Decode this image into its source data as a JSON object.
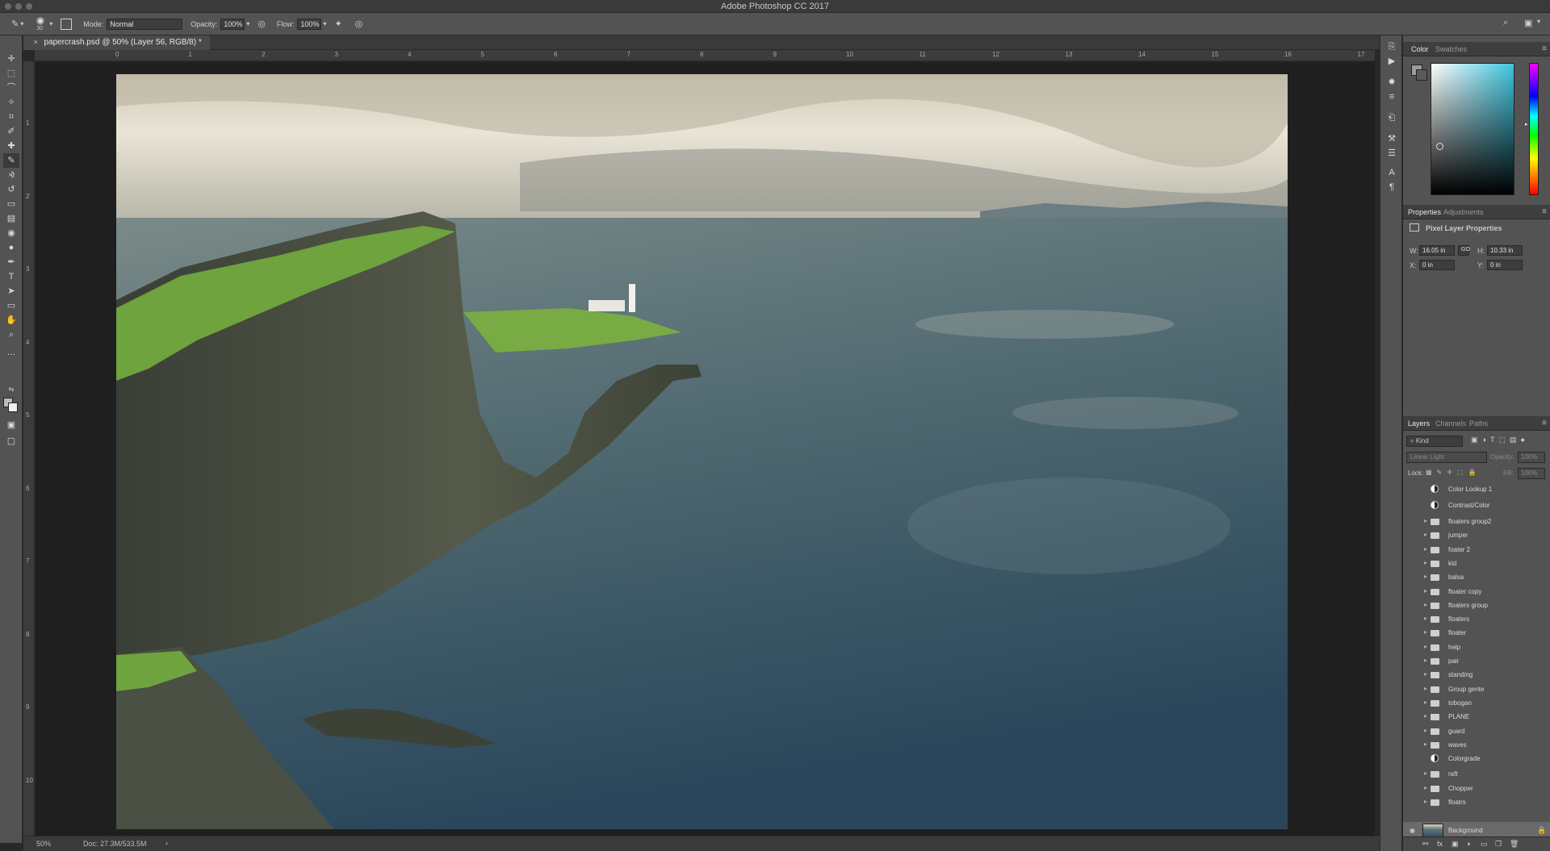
{
  "window": {
    "title": "Adobe Photoshop CC 2017"
  },
  "options": {
    "brush_size": "30",
    "mode_label": "Mode:",
    "mode_value": "Normal",
    "opacity_label": "Opacity:",
    "opacity_value": "100%",
    "flow_label": "Flow:",
    "flow_value": "100%"
  },
  "document": {
    "tab_title": "papercrash.psd @ 50% (Layer 56, RGB/8) *"
  },
  "rulers": {
    "top": [
      "0",
      "1",
      "2",
      "3",
      "4",
      "5",
      "6",
      "7",
      "8",
      "9",
      "10",
      "11",
      "12",
      "13",
      "14",
      "15",
      "16",
      "17"
    ],
    "left": [
      "1",
      "2",
      "3",
      "4",
      "5",
      "6",
      "7",
      "8",
      "9",
      "10"
    ]
  },
  "status": {
    "zoom": "50%",
    "doc_size": "Doc: 27.3M/533.5M"
  },
  "panels": {
    "color_tabs": [
      "Color",
      "Swatches"
    ],
    "props_tabs": [
      "Properties",
      "Adjustments"
    ],
    "props_title": "Pixel Layer Properties",
    "w_label": "W:",
    "w_value": "16.05 in",
    "h_label": "H:",
    "h_value": "10.33 in",
    "x_label": "X:",
    "x_value": "0 in",
    "y_label": "Y:",
    "y_value": "0 in",
    "go_label": "GO",
    "layers_tabs": [
      "Layers",
      "Channels",
      "Paths"
    ],
    "kind_label": "Kind",
    "blend_mode": "Linear Light",
    "opacity_label": "Opacity:",
    "opacity_value": "100%",
    "lock_label": "Lock:",
    "fill_label": "Fill:",
    "fill_value": "100%"
  },
  "layers": [
    {
      "name": "Color Lookup 1",
      "type": "adjustment"
    },
    {
      "name": "Contrast/Color",
      "type": "adjustment"
    },
    {
      "name": "floaters group2",
      "type": "group"
    },
    {
      "name": "jumper",
      "type": "group"
    },
    {
      "name": "foater 2",
      "type": "group"
    },
    {
      "name": "kid",
      "type": "group"
    },
    {
      "name": "balsa",
      "type": "group"
    },
    {
      "name": "floater copy",
      "type": "group"
    },
    {
      "name": "floaters group",
      "type": "group"
    },
    {
      "name": "floaters",
      "type": "group"
    },
    {
      "name": "floater",
      "type": "group"
    },
    {
      "name": "help",
      "type": "group"
    },
    {
      "name": "pair",
      "type": "group"
    },
    {
      "name": "standing",
      "type": "group"
    },
    {
      "name": "Group gente",
      "type": "group"
    },
    {
      "name": "tobogan",
      "type": "group"
    },
    {
      "name": "PLANE",
      "type": "group"
    },
    {
      "name": "guard",
      "type": "group"
    },
    {
      "name": "waves",
      "type": "group"
    },
    {
      "name": "Colorgrade",
      "type": "adjustment"
    },
    {
      "name": "raft",
      "type": "group"
    },
    {
      "name": "Chopper",
      "type": "group"
    },
    {
      "name": "floatrs",
      "type": "group"
    }
  ],
  "background_layer": {
    "name": "Background"
  }
}
